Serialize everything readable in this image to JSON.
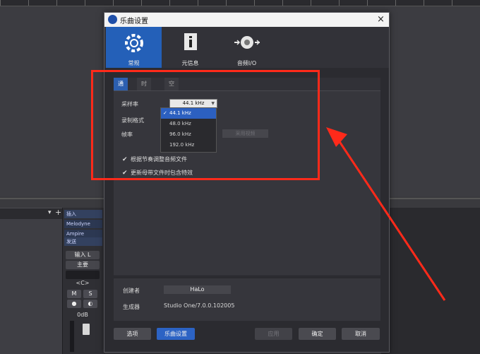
{
  "dialog": {
    "title": "乐曲设置",
    "close_glyph": "×",
    "top_tabs": [
      {
        "label": "常规",
        "icon": "gear-icon",
        "active": true
      },
      {
        "label": "元信息",
        "icon": "info-icon",
        "active": false
      },
      {
        "label": "音频I/O",
        "icon": "audio-io-icon",
        "active": false
      }
    ],
    "sub_tabs": [
      "通用",
      "时间线",
      "空间音频"
    ],
    "sample_rate_label": "采样率",
    "sample_rate_value": "44.1 kHz",
    "record_format_label": "录制格式",
    "frame_rate_label": "帧率",
    "disabled_button": "采用视频",
    "dropdown_options": [
      "44.1 kHz",
      "48.0 kHz",
      "96.0 kHz",
      "192.0 kHz"
    ],
    "dropdown_selected": "44.1 kHz",
    "checkboxes": [
      {
        "label": "根据节奏调整音频文件",
        "checked": true
      },
      {
        "label": "更新母带文件时包含特效",
        "checked": true
      }
    ],
    "creator_label": "创建者",
    "creator_value": "HaLo",
    "generator_label": "生成器",
    "generator_value": "Studio One/7.0.0.102005",
    "buttons": {
      "options": "选项",
      "song_settings": "乐曲设置",
      "apply": "应用",
      "ok": "确定",
      "cancel": "取消"
    }
  },
  "mixer": {
    "inserts": "插入",
    "plugin1": "Melodyne",
    "plugin2": "Ampire",
    "sends": "发送",
    "input": "输入 L",
    "output": "主要",
    "pan": "<C>",
    "mute": "M",
    "solo": "S",
    "volume": "0dB"
  },
  "colors": {
    "accent": "#2c63c4",
    "annotation_red": "#ff2a1a"
  }
}
